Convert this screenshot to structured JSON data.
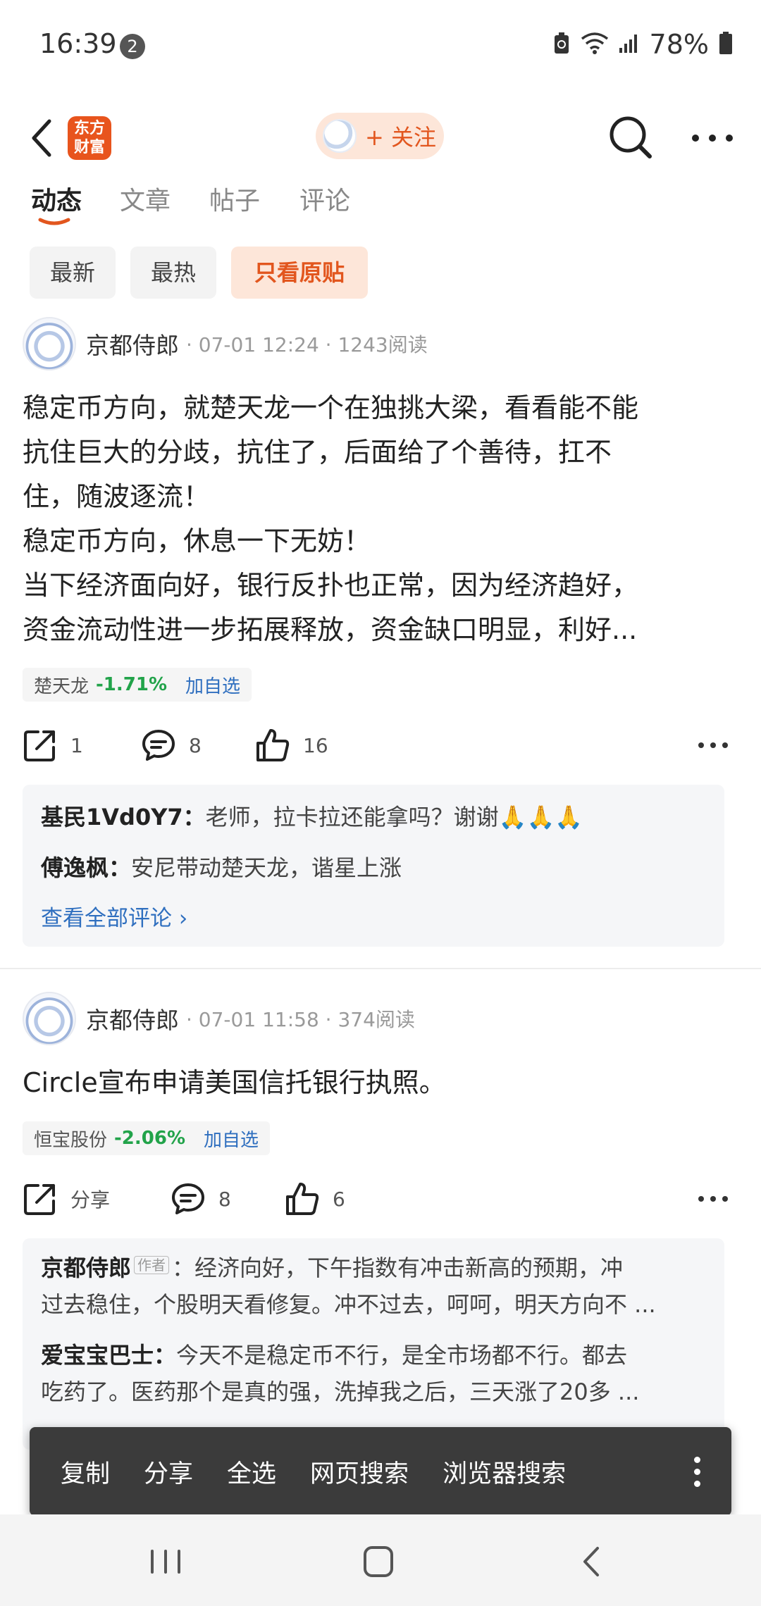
{
  "status_bar": {
    "time": "16:39",
    "notification_count": "2",
    "battery": "78%"
  },
  "header": {
    "logo_line1": "东方",
    "logo_line2": "财富",
    "follow_label": "+ 关注"
  },
  "tabs": [
    {
      "label": "动态",
      "active": true
    },
    {
      "label": "文章",
      "active": false
    },
    {
      "label": "帖子",
      "active": false
    },
    {
      "label": "评论",
      "active": false
    }
  ],
  "filters": [
    {
      "label": "最新",
      "active": false
    },
    {
      "label": "最热",
      "active": false
    },
    {
      "label": "只看原贴",
      "active": true
    }
  ],
  "posts": [
    {
      "author": "京都侍郎",
      "meta": "· 07-01 12:24 · 1243阅读",
      "lines": [
        "稳定币方向，就楚天龙一个在独挑大梁，看看能不能",
        "抗住巨大的分歧，抗住了，后面给了个善待，扛不",
        "住，随波逐流！",
        "稳定币方向，休息一下无妨！",
        "当下经济面向好，银行反扑也正常，因为经济趋好，",
        "资金流动性进一步拓展释放，资金缺口明显，利好..."
      ],
      "stock": {
        "name": "楚天龙",
        "change": "-1.71%",
        "add": "加自选"
      },
      "actions": {
        "share": "1",
        "comments": "8",
        "likes": "16"
      },
      "comments": [
        {
          "user": "基民1Vd0Y7：",
          "text": "老师，拉卡拉还能拿吗？谢谢🙏🙏🙏",
          "author_tag": ""
        },
        {
          "user": "傅逸枫：",
          "text": "安尼带动楚天龙，谐星上涨",
          "author_tag": ""
        }
      ],
      "see_all": "查看全部评论 ›"
    },
    {
      "author": "京都侍郎",
      "meta": "· 07-01 11:58 · 374阅读",
      "lines": [
        "Circle宣布申请美国信托银行执照。"
      ],
      "stock": {
        "name": "恒宝股份",
        "change": "-2.06%",
        "add": "加自选"
      },
      "actions": {
        "share": "分享",
        "comments": "8",
        "likes": "6"
      },
      "comments": [
        {
          "user": "京都侍郎",
          "author_tag": "作者",
          "line1": "：经济向好，下午指数有冲击新高的预期，冲",
          "line2": "过去稳住，个股明天看修复。冲不过去，呵呵，明天方向不 ..."
        },
        {
          "user": "爱宝宝巴士：",
          "line1": "今天不是稳定币不行，是全市场都不行。都去",
          "line2": "吃药了。医药那个是真的强，洗掉我之后，三天涨了20多   ..."
        }
      ]
    }
  ],
  "context_menu": [
    "复制",
    "分享",
    "全选",
    "网页搜索",
    "浏览器搜索"
  ],
  "colors": {
    "accent": "#e2561e",
    "link": "#2f6fbf",
    "down": "#22a34a",
    "menu_bg": "#3b3b3b"
  }
}
